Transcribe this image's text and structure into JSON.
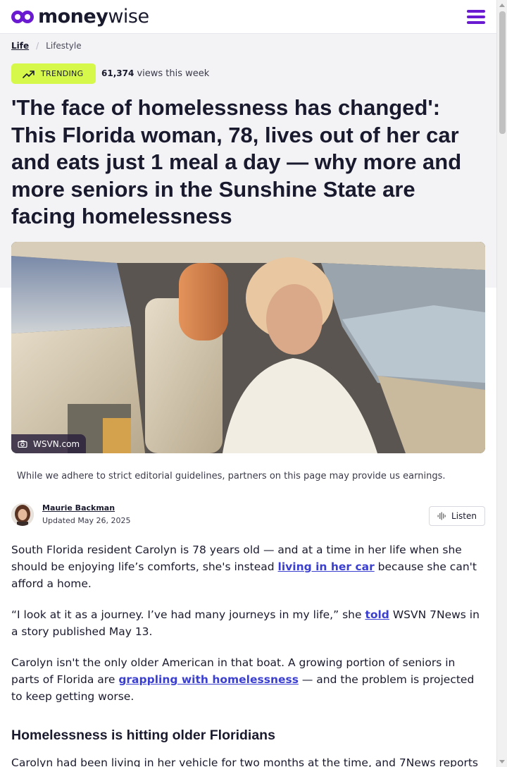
{
  "header": {
    "logo_bold": "money",
    "logo_light": "wise",
    "menu_icon": "hamburger-menu-icon"
  },
  "colors": {
    "brand_purple": "#6a1bd1",
    "trending_green": "#d6f84a",
    "link_blue": "#3b3fd0",
    "hero_background": "#f3f3f6"
  },
  "breadcrumb": {
    "section": "Life",
    "separator": "/",
    "subsection": "Lifestyle"
  },
  "trending": {
    "label": "TRENDING",
    "icon": "trending-up-icon",
    "views_count": "61,374",
    "views_suffix": "views this week"
  },
  "article": {
    "headline": "'The face of homelessness has changed': This Florida woman, 78, lives out of her car and eats just 1 meal a day — why more and more seniors in the Sunshine State are facing homelessness",
    "image_credit": "WSVN.com",
    "image_credit_icon": "camera-icon",
    "disclosure": "While we adhere to strict editorial guidelines, partners on this page may provide us earnings.",
    "author": "Maurie Backman",
    "updated": "Updated May 26, 2025",
    "listen_label": "Listen",
    "listen_icon": "audio-wave-icon",
    "p1_before": "South Florida resident Carolyn is 78 years old — and at a time in her life when she should be enjoying life’s comforts, she's instead ",
    "p1_link": "living in her car",
    "p1_after": " because she can't afford a home.",
    "p2_before": "“I look at it as a journey. I’ve had many journeys in my life,” she ",
    "p2_link": "told",
    "p2_after": " WSVN 7News in a story published May 13.",
    "p3_before": "Carolyn isn't the only older American in that boat. A growing portion of seniors in parts of Florida are ",
    "p3_link": "grappling with homelessness",
    "p3_after": " — and the problem is projected to keep getting worse.",
    "subheading": "Homelessness is hitting older Floridians",
    "p4": "Carolyn had been living in her vehicle for two months at the time, and 7News reports"
  }
}
